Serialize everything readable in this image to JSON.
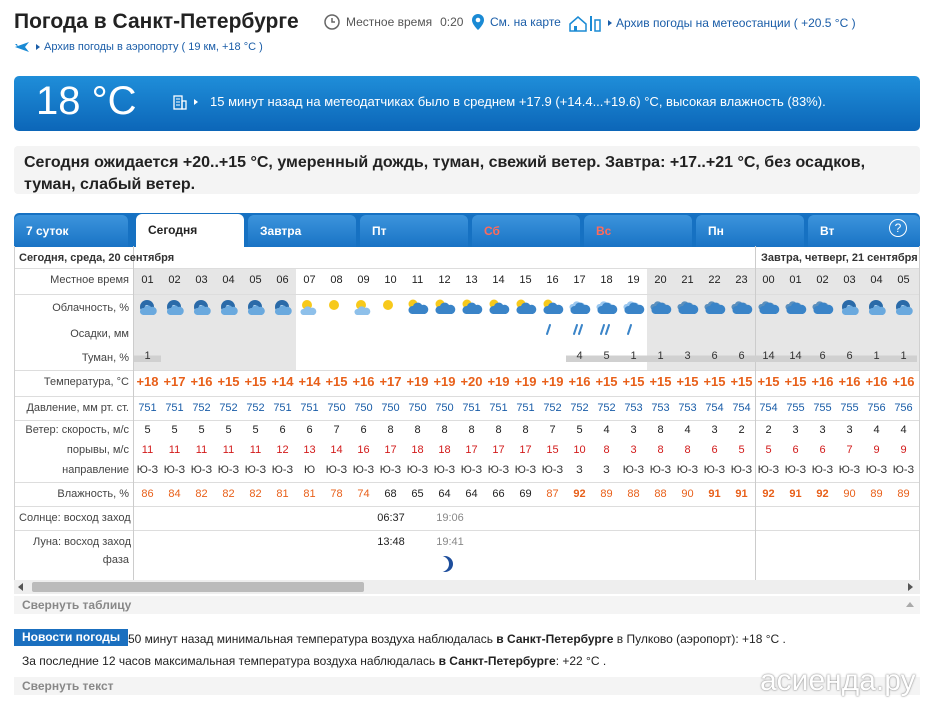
{
  "header": {
    "title": "Погода в Санкт-Петербурге",
    "local_time_label": "Местное время",
    "local_time": "0:20",
    "map_link": "См. на карте",
    "station_link": "Архив погоды на метеостанции ( +20.5 °C )",
    "airport_link": "Архив погоды в аэропорту ( 19 км, +18 °C )"
  },
  "current": {
    "temp": "18 °C",
    "text": "15 минут назад на метеодатчиках было в среднем +17.9 (+14.4...+19.6) °C, высокая влажность (83%)."
  },
  "forecast_text": "Сегодня ожидается +20..+15 °C, умеренный дождь, туман, свежий ветер. Завтра: +17..+21 °C, без осадков, туман, слабый ветер.",
  "tabs": [
    {
      "label": "7 суток",
      "weekend": false,
      "selected": false
    },
    {
      "label": "Сегодня",
      "weekend": false,
      "selected": true
    },
    {
      "label": "Завтра",
      "weekend": false,
      "selected": false
    },
    {
      "label": "Пт",
      "weekend": false,
      "selected": false
    },
    {
      "label": "Сб",
      "weekend": true,
      "selected": false
    },
    {
      "label": "Вс",
      "weekend": true,
      "selected": false
    },
    {
      "label": "Пн",
      "weekend": false,
      "selected": false
    },
    {
      "label": "Вт",
      "weekend": false,
      "selected": false
    }
  ],
  "help": "?",
  "table": {
    "date_today": "Сегодня, среда, 20 сентября",
    "date_tomorrow": "Завтра, четверг, 21 сентября",
    "labels": {
      "time": "Местное время",
      "cloud": "Облачность, %",
      "precip": "Осадки, мм",
      "fog": "Туман, %",
      "temp": "Температура, °C",
      "pressure": "Давление, мм рт. ст.",
      "wind": "Ветер: скорость, м/с",
      "gusts": "порывы, м/с",
      "dir": "направление",
      "humidity": "Влажность, %",
      "sun": "Солнце: восход заход",
      "moon": "Луна: восход заход",
      "phase": "фаза"
    },
    "hours": [
      "01",
      "02",
      "03",
      "04",
      "05",
      "06",
      "07",
      "08",
      "09",
      "10",
      "11",
      "12",
      "13",
      "14",
      "15",
      "16",
      "17",
      "18",
      "19",
      "20",
      "21",
      "22",
      "23",
      "00",
      "01",
      "02",
      "03",
      "04",
      "05"
    ],
    "cloud_icons": [
      "night-partly",
      "night-partly",
      "night-partly",
      "night-partly",
      "night-partly",
      "night-partly",
      "sun-partly",
      "sun",
      "sun-partly",
      "sun",
      "sun-cloud",
      "sun-cloud",
      "sun-cloud",
      "sun-cloud",
      "sun-cloud",
      "sun-cloud",
      "cloudy",
      "cloudy",
      "cloudy",
      "night-cloudy",
      "night-cloudy",
      "night-cloudy",
      "night-cloudy",
      "night-cloudy",
      "night-cloudy",
      "night-cloudy",
      "night-partly",
      "night-partly",
      "night-partly"
    ],
    "precip": [
      "",
      "",
      "",
      "",
      "",
      "",
      "",
      "",
      "",
      "",
      "",
      "",
      "",
      "",
      "",
      "1",
      "2",
      "2",
      "1",
      "",
      "",
      "",
      "",
      "",
      "",
      "",
      "",
      "",
      ""
    ],
    "fog": [
      "1",
      "",
      "",
      "",
      "",
      "",
      "",
      "",
      "",
      "",
      "",
      "",
      "",
      "",
      "",
      "",
      "4",
      "5",
      "1",
      "1",
      "3",
      "6",
      "6",
      "14",
      "14",
      "6",
      "6",
      "1",
      "1"
    ],
    "temps": [
      "+18",
      "+17",
      "+16",
      "+15",
      "+15",
      "+14",
      "+14",
      "+15",
      "+16",
      "+17",
      "+19",
      "+19",
      "+20",
      "+19",
      "+19",
      "+19",
      "+16",
      "+15",
      "+15",
      "+15",
      "+15",
      "+15",
      "+15",
      "+15",
      "+15",
      "+16",
      "+16",
      "+16",
      "+16"
    ],
    "pressure": [
      "751",
      "751",
      "752",
      "752",
      "752",
      "751",
      "751",
      "750",
      "750",
      "750",
      "750",
      "750",
      "751",
      "751",
      "751",
      "752",
      "752",
      "752",
      "753",
      "753",
      "753",
      "754",
      "754",
      "754",
      "755",
      "755",
      "755",
      "756",
      "756"
    ],
    "wind": [
      "5",
      "5",
      "5",
      "5",
      "5",
      "6",
      "6",
      "7",
      "6",
      "8",
      "8",
      "8",
      "8",
      "8",
      "8",
      "7",
      "5",
      "4",
      "3",
      "8",
      "4",
      "3",
      "2",
      "2",
      "3",
      "3",
      "3",
      "4",
      "4"
    ],
    "gusts": [
      "11",
      "11",
      "11",
      "11",
      "11",
      "12",
      "13",
      "14",
      "16",
      "17",
      "18",
      "18",
      "17",
      "17",
      "17",
      "15",
      "10",
      "8",
      "3",
      "8",
      "8",
      "6",
      "5",
      "5",
      "6",
      "6",
      "7",
      "9",
      "9"
    ],
    "dir": [
      "Ю-З",
      "Ю-З",
      "Ю-З",
      "Ю-З",
      "Ю-З",
      "Ю-З",
      "Ю",
      "Ю-З",
      "Ю-З",
      "Ю-З",
      "Ю-З",
      "Ю-З",
      "Ю-З",
      "Ю-З",
      "Ю-З",
      "Ю-З",
      "З",
      "З",
      "Ю-З",
      "Ю-З",
      "Ю-З",
      "Ю-З",
      "Ю-З",
      "Ю-З",
      "Ю-З",
      "Ю-З",
      "Ю-З",
      "Ю-З",
      "Ю-З"
    ],
    "humidity": [
      "86",
      "84",
      "82",
      "82",
      "82",
      "81",
      "81",
      "78",
      "74",
      "68",
      "65",
      "64",
      "64",
      "66",
      "69",
      "87",
      "92",
      "89",
      "88",
      "88",
      "90",
      "91",
      "91",
      "92",
      "91",
      "92",
      "90",
      "89",
      "89"
    ],
    "sunrise": "06:37",
    "sunset": "19:06",
    "moonrise": "13:48",
    "moonset": "19:41",
    "colors": {
      "temp": "#e8601a",
      "humid_high": "#e8601a",
      "grid_line": "#dddddd"
    }
  },
  "collapse_table": "Свернуть таблицу",
  "news": {
    "badge": "Новости погоды",
    "line1_a": "50 минут назад минимальная температура воздуха наблюдалась ",
    "line1_b": "в Санкт-Петербурге",
    "line1_c": " в Пулково (аэропорт): +18 °С .",
    "line2_a": "За последние 12 часов максимальная температура воздуха наблюдалась ",
    "line2_b": "в Санкт-Петербурге",
    "line2_c": ": +22 °С ."
  },
  "collapse_text": "Свернуть текст",
  "watermark": "асиенда.ру"
}
